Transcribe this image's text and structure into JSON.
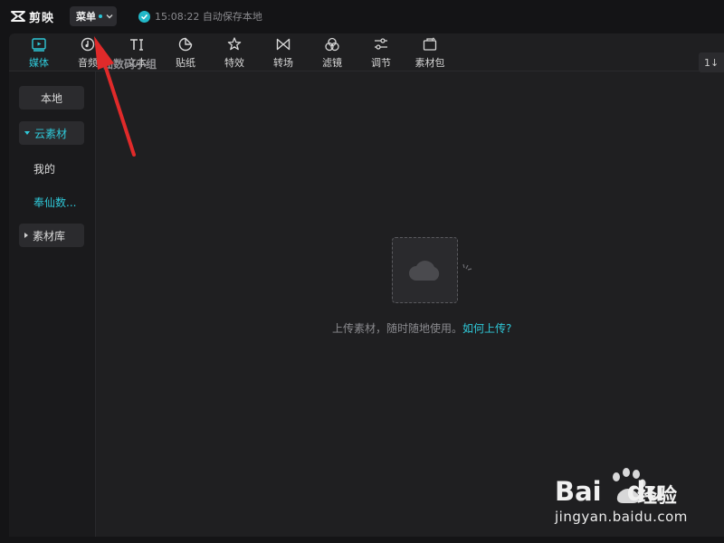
{
  "app": {
    "name": "剪映",
    "menu_label": "菜单",
    "save_status": "15:08:22 自动保存本地",
    "accent_color": "#2fc8d8"
  },
  "tabs": [
    {
      "label": "媒体",
      "icon": "media-icon",
      "active": true
    },
    {
      "label": "音频",
      "icon": "audio-icon",
      "active": false
    },
    {
      "label": "文本",
      "icon": "text-icon",
      "active": false
    },
    {
      "label": "贴纸",
      "icon": "sticker-icon",
      "active": false
    },
    {
      "label": "特效",
      "icon": "effects-icon",
      "active": false
    },
    {
      "label": "转场",
      "icon": "transition-icon",
      "active": false
    },
    {
      "label": "滤镜",
      "icon": "filter-icon",
      "active": false
    },
    {
      "label": "调节",
      "icon": "adjust-icon",
      "active": false
    },
    {
      "label": "素材包",
      "icon": "asset-pack-icon",
      "active": false
    }
  ],
  "sidebar": {
    "local": "本地",
    "cloud": "云素材",
    "mine": "我的",
    "team": "奉仙数...",
    "library": "素材库"
  },
  "main": {
    "breadcrumb": "仙数码小组",
    "sort_label": "1↓",
    "empty_text": "上传素材，随时随地使用。",
    "empty_link": "如何上传?"
  },
  "watermark": {
    "brand": "Bai",
    "brand_tail": "du",
    "product": "经验",
    "url": "jingyan.baidu.com"
  }
}
